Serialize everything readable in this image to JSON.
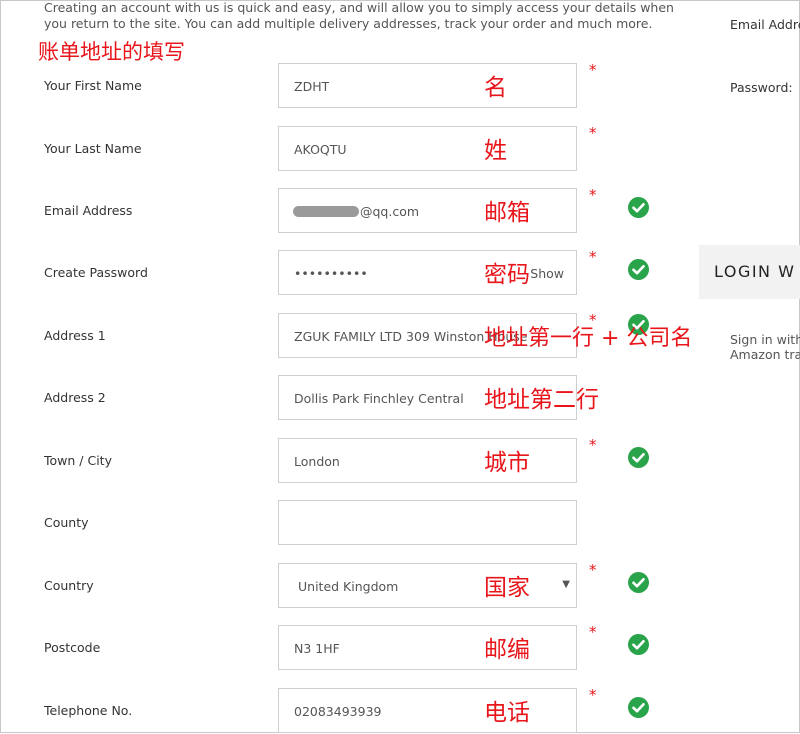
{
  "intro": {
    "line1": "Creating an account with us is quick and easy, and will allow you to simply access your details when",
    "line2": "you return to the site. You can add multiple delivery addresses, track your order and much more."
  },
  "annotation_billing": "账单地址的填写",
  "required_mark": "*",
  "fields": [
    {
      "label": "Your First Name",
      "value": "ZDHT",
      "annotation": "名",
      "required": true,
      "valid": false
    },
    {
      "label": "Your Last Name",
      "value": "AKOQTU",
      "annotation": "姓",
      "required": true,
      "valid": false
    },
    {
      "label": "Email Address",
      "value": "@qq.com",
      "annotation": "邮箱",
      "required": true,
      "valid": true
    },
    {
      "label": "Create Password",
      "value": "••••••••••",
      "show_label": "Show",
      "annotation": "密码",
      "required": true,
      "valid": true
    },
    {
      "label": "Address 1",
      "value": "ZGUK FAMILY LTD 309 Winston House",
      "annotation": "地址第一行 + 公司名",
      "required": true,
      "valid": true
    },
    {
      "label": "Address 2",
      "value": "Dollis Park Finchley Central",
      "annotation": "地址第二行",
      "required": false,
      "valid": false
    },
    {
      "label": "Town / City",
      "value": "London",
      "annotation": "城市",
      "required": true,
      "valid": true
    },
    {
      "label": "County",
      "value": "",
      "annotation": "",
      "required": false,
      "valid": false
    },
    {
      "label": "Country",
      "value": "United Kingdom",
      "annotation": "国家",
      "required": true,
      "valid": true
    },
    {
      "label": "Postcode",
      "value": "N3 1HF",
      "annotation": "邮编",
      "required": true,
      "valid": true
    },
    {
      "label": "Telephone No.",
      "value": "02083493939",
      "annotation": "电话",
      "required": true,
      "valid": true
    }
  ],
  "side": {
    "email_label": "Email Addre",
    "password_label": "Password:",
    "login_button": "LOGIN W",
    "signin_line1": "Sign in with",
    "signin_line2": "Amazon tra"
  },
  "colors": {
    "annotation": "#e8161b",
    "valid": "#2aa44a"
  },
  "icons": {
    "valid": "check-circle-icon",
    "dropdown": "caret-down-icon"
  }
}
